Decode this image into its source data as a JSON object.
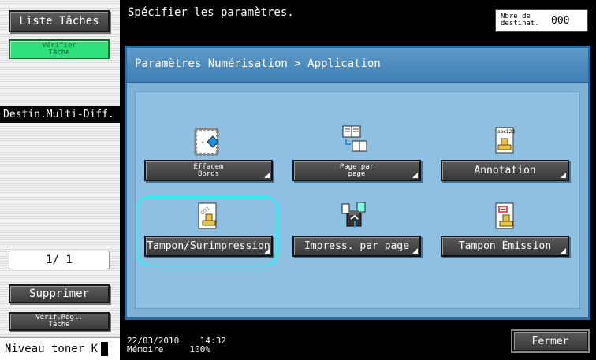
{
  "left_panel": {
    "job_list": "Liste Tâches",
    "check_job_line1": "Vérifier",
    "check_job_line2": "Tâche",
    "multi_dest": "Destin.Multi-Diff.",
    "page_indicator": "1/ 1",
    "delete": "Supprimer",
    "check_settings_line1": "Vérif.Régl.",
    "check_settings_line2": "Tâche",
    "toner_label": "Niveau toner K"
  },
  "header": {
    "prompt": "Spécifier les paramètres.",
    "dest_label_line1": "Nbre de",
    "dest_label_line2": "destinat.",
    "dest_count": "000"
  },
  "panel": {
    "breadcrumb": "Paramètres Numérisation > Application",
    "items": [
      {
        "label_line1": "Effacem",
        "label_line2": "Bords",
        "icon": "frame-erase-icon"
      },
      {
        "label_line1": "Page par",
        "label_line2": "page",
        "icon": "book-copy-icon"
      },
      {
        "label_line1": "Annotation",
        "label_line2": "",
        "icon": "annotation-stamp-icon"
      },
      {
        "label_line1": "Tampon/Surimpression",
        "label_line2": "",
        "icon": "stamp-composition-icon"
      },
      {
        "label_line1": "Impress. par page",
        "label_line2": "",
        "icon": "page-print-icon"
      },
      {
        "label_line1": "Tampon Émission",
        "label_line2": "",
        "icon": "send-stamp-icon"
      }
    ]
  },
  "footer": {
    "date": "22/03/2010",
    "time": "14:32",
    "memory_label": "Mémoire",
    "memory_value": "100%",
    "close": "Fermer"
  },
  "colors": {
    "accent": "#2ee07a",
    "panel_blue": "#7fb1d6",
    "highlight": "#40e6f0"
  }
}
